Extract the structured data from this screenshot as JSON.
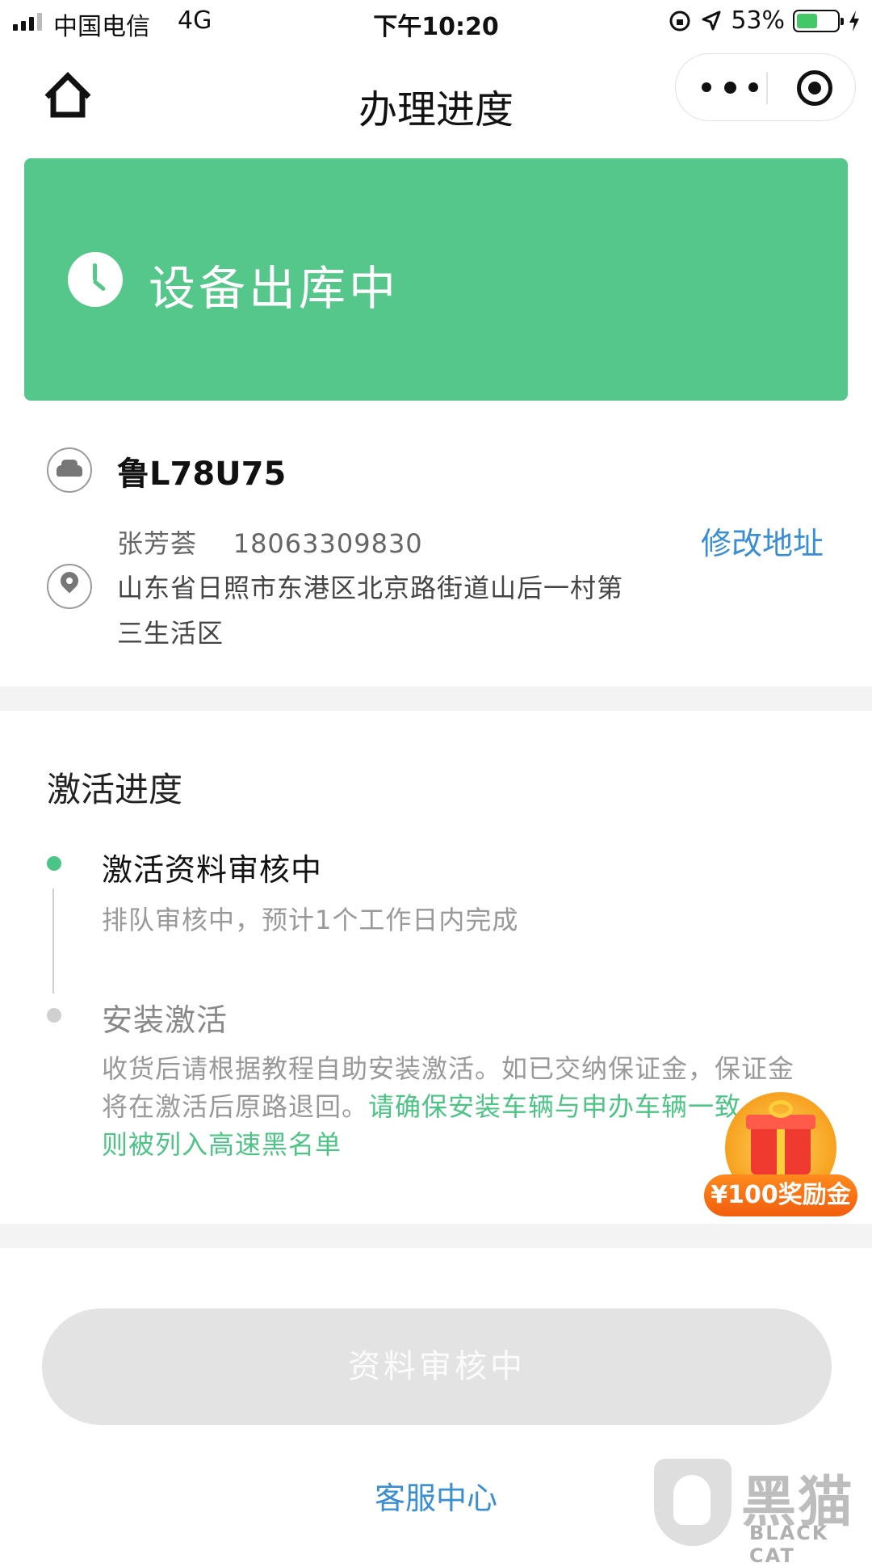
{
  "status_bar": {
    "carrier": "中国电信",
    "network": "4G",
    "time": "下午10:20",
    "battery": "53%",
    "battery_level": 0.53
  },
  "nav": {
    "title": "办理进度",
    "home_icon": "home-icon",
    "more_icon": "more-dots-icon",
    "close_icon": "target-circle-icon"
  },
  "banner": {
    "icon": "clock-icon",
    "status_text": "设备出库中",
    "color": "#55c78a"
  },
  "vehicle": {
    "plate": "鲁L78U75"
  },
  "address": {
    "name": "张芳荟",
    "phone": "18063309830",
    "edit_label": "修改地址",
    "line1": "山东省日照市东港区北京路街道山后一村第",
    "line2": "三生活区"
  },
  "progress": {
    "title": "激活进度",
    "steps": [
      {
        "title": "激活资料审核中",
        "desc": "排队审核中，预计1个工作日内完成"
      },
      {
        "title": "安装激活",
        "desc_line1": "收货后请根据教程自助安装激活。如已交纳保证金，保证金",
        "desc_line2_plain": "将在激活后原路退回。",
        "desc_line2_warn": "请确保安装车辆与申办车辆一致，否",
        "desc_line3_warn": "则被列入高速黑名单"
      }
    ]
  },
  "reward": {
    "label": "¥100奖励金"
  },
  "actions": {
    "primary_button": "资料审核中",
    "service_link": "客服中心"
  },
  "watermark": {
    "cn": "黑猫",
    "en": "BLACK CAT"
  },
  "colors": {
    "accent_green": "#4cc486",
    "link_blue": "#3a8ed4"
  }
}
